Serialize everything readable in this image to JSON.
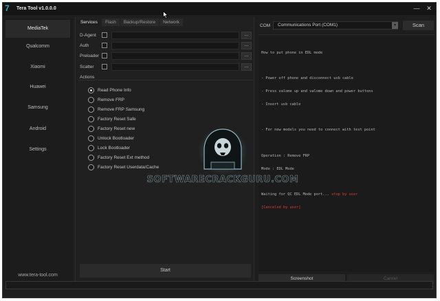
{
  "window": {
    "title": "Tera Tool v1.0.0.0",
    "minimize": "—",
    "close": "✕"
  },
  "sidebar": {
    "items": [
      {
        "label": "MediaTek",
        "active": true
      },
      {
        "label": "Qualcomm",
        "active": false
      },
      {
        "label": "Xiaomi",
        "active": false
      },
      {
        "label": "Huawei",
        "active": false
      },
      {
        "label": "Samsung",
        "active": false
      },
      {
        "label": "Android",
        "active": false
      },
      {
        "label": "Settings",
        "active": false
      }
    ],
    "footer": "www.tera-tool.com"
  },
  "tabs": [
    {
      "label": "Services",
      "active": true
    },
    {
      "label": "Flash",
      "active": false
    },
    {
      "label": "Backup/Restore",
      "active": false
    },
    {
      "label": "Network",
      "active": false
    }
  ],
  "services": {
    "rows": [
      {
        "label": "D-Agent",
        "checked": false,
        "value": "",
        "browse": "..."
      },
      {
        "label": "Auth",
        "checked": false,
        "value": "",
        "browse": "..."
      },
      {
        "label": "Preloader",
        "checked": false,
        "value": "",
        "browse": "..."
      },
      {
        "label": "Scatter",
        "checked": false,
        "value": "",
        "browse": "..."
      }
    ]
  },
  "actions": {
    "title": "Actions",
    "options": [
      {
        "label": "Read Phone Info",
        "selected": true
      },
      {
        "label": "Remove FRP",
        "selected": false
      },
      {
        "label": "Remove FRP Samsung",
        "selected": false
      },
      {
        "label": "Factory Reset Safe",
        "selected": false
      },
      {
        "label": "Factory Reset new",
        "selected": false
      },
      {
        "label": "Unlock Bootloader",
        "selected": false
      },
      {
        "label": "Lock Bootloader",
        "selected": false
      },
      {
        "label": "Factory Reset Ext method",
        "selected": false
      },
      {
        "label": "Factory Reset Userdata/Cache",
        "selected": false
      }
    ],
    "start": "Start"
  },
  "com": {
    "label": "COM",
    "selected": "Communications Port (COM1)",
    "arrow": "▾",
    "scan": "Scan"
  },
  "log": {
    "lines": [
      "How to put phone in EDL mode",
      "",
      "- Power off phone and disconnect usb cable",
      "- Press valome up and valome down and power buttons",
      "- Insert usb cable",
      "",
      "- For new models you need to connect with test point",
      "",
      "Operation : Remove FRP",
      "Mode : EDL Mode",
      ""
    ],
    "waiting": "Waiting for QC EDL Mode port... ",
    "stop": "stop by user",
    "canceled": "[Canceled by user]"
  },
  "bottom": {
    "screenshot": "Screenshot",
    "cancel": "Cancel"
  },
  "watermark": {
    "text": "SOFTWARECRACKGURU.COM"
  },
  "colors": {
    "accent": "#3aa7c0",
    "error": "#e23b3b",
    "background": "#1f1f1f"
  }
}
